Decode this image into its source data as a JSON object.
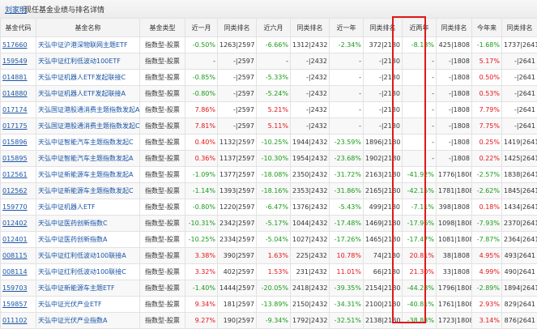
{
  "header": {
    "manager_name": "刘家明",
    "title": "现任基金业绩与排名详情"
  },
  "table": {
    "columns": [
      "基金代码",
      "基金名称",
      "基金类型",
      "近一月",
      "同类排名",
      "近六月",
      "同类排名",
      "近一年",
      "同类排名",
      "近两年",
      "同类排名",
      "今年来",
      "同类排名"
    ],
    "rows": [
      [
        "517660",
        "天弘中证沪港深物联网主题ETF",
        "指数型-股票",
        "-0.50%",
        "1263|2597",
        "-6.66%",
        "1312|2432",
        "-2.34%",
        "372|2180",
        "-8.18%",
        "425|1808",
        "-1.68%",
        "1737|2641"
      ],
      [
        "159549",
        "天弘中证红利低波动100ETF",
        "指数型-股票",
        "-",
        "-|2597",
        "-",
        "-|2432",
        "-",
        "-|2180",
        "-",
        "-|1808",
        "5.17%",
        "-|2641"
      ],
      [
        "014881",
        "天弘中证机器人ETF发起联接C",
        "指数型-股票",
        "-0.85%",
        "-|2597",
        "-5.33%",
        "-|2432",
        "-",
        "-|2180",
        "-",
        "-|1808",
        "0.50%",
        "-|2641"
      ],
      [
        "014880",
        "天弘中证机器人ETF发起联接A",
        "指数型-股票",
        "-0.80%",
        "-|2597",
        "-5.24%",
        "-|2432",
        "-",
        "-|2180",
        "-",
        "-|1808",
        "0.53%",
        "-|2641"
      ],
      [
        "017174",
        "天弘国证港股通消费主题指数发起A",
        "指数型-股票",
        "7.86%",
        "-|2597",
        "5.21%",
        "-|2432",
        "-",
        "-|2180",
        "-",
        "-|1808",
        "7.79%",
        "-|2641"
      ],
      [
        "017175",
        "天弘国证港股通消费主题指数发起C",
        "指数型-股票",
        "7.81%",
        "-|2597",
        "5.11%",
        "-|2432",
        "-",
        "-|2180",
        "-",
        "-|1808",
        "7.75%",
        "-|2641"
      ],
      [
        "015896",
        "天弘中证智能汽车主题指数发起C",
        "指数型-股票",
        "0.40%",
        "1132|2597",
        "-10.25%",
        "1944|2432",
        "-23.59%",
        "1896|2180",
        "-",
        "-|1808",
        "0.25%",
        "1419|2641"
      ],
      [
        "015895",
        "天弘中证智能汽车主题指数发起A",
        "指数型-股票",
        "0.36%",
        "1137|2597",
        "-10.30%",
        "1954|2432",
        "-23.68%",
        "1902|2180",
        "-",
        "-|1808",
        "0.22%",
        "1425|2641"
      ],
      [
        "012561",
        "天弘中证新能源车主题指数发起A",
        "指数型-股票",
        "-1.09%",
        "1377|2597",
        "-18.08%",
        "2350|2432",
        "-31.72%",
        "2163|2180",
        "-41.92%",
        "1776|1808",
        "-2.57%",
        "1838|2641"
      ],
      [
        "012562",
        "天弘中证新能源车主题指数发起C",
        "指数型-股票",
        "-1.14%",
        "1393|2597",
        "-18.16%",
        "2353|2432",
        "-31.86%",
        "2165|2180",
        "-42.15%",
        "1781|1808",
        "-2.62%",
        "1845|2641"
      ],
      [
        "159770",
        "天弘中证机器人ETF",
        "指数型-股票",
        "-0.80%",
        "1220|2597",
        "-6.47%",
        "1376|2432",
        "-5.43%",
        "499|2180",
        "-7.11%",
        "398|1808",
        "0.18%",
        "1434|2641"
      ],
      [
        "012402",
        "天弘中证医药创新指数C",
        "指数型-股票",
        "-10.31%",
        "2342|2597",
        "-5.17%",
        "1044|2432",
        "-17.48%",
        "1469|2180",
        "-17.96%",
        "1098|1808",
        "-7.93%",
        "2370|2641"
      ],
      [
        "012401",
        "天弘中证医药创新指数A",
        "指数型-股票",
        "-10.25%",
        "2334|2597",
        "-5.04%",
        "1027|2432",
        "-17.26%",
        "1465|2180",
        "-17.47%",
        "1081|1808",
        "-7.87%",
        "2364|2641"
      ],
      [
        "008115",
        "天弘中证红利低波动100联接A",
        "指数型-股票",
        "3.38%",
        "390|2597",
        "1.63%",
        "225|2432",
        "10.78%",
        "74|2180",
        "20.81%",
        "38|1808",
        "4.95%",
        "493|2641"
      ],
      [
        "008114",
        "天弘中证红利低波动100联接C",
        "指数型-股票",
        "3.32%",
        "402|2597",
        "1.53%",
        "231|2432",
        "11.01%",
        "66|2180",
        "21.30%",
        "33|1808",
        "4.99%",
        "490|2641"
      ],
      [
        "159703",
        "天弘中证新能源车主题ETF",
        "指数型-股票",
        "-1.40%",
        "1444|2597",
        "-20.05%",
        "2418|2432",
        "-39.35%",
        "2154|2180",
        "-44.28%",
        "1796|1808",
        "-2.89%",
        "1894|2641"
      ],
      [
        "159857",
        "天弘中证光伏产业ETF",
        "指数型-股票",
        "9.34%",
        "181|2597",
        "-13.89%",
        "2150|2432",
        "-34.31%",
        "2100|2180",
        "-40.81%",
        "1761|1808",
        "2.93%",
        "829|2641"
      ],
      [
        "011102",
        "天弘中证光伏产业指数A",
        "指数型-股票",
        "9.27%",
        "190|2597",
        "-9.34%",
        "1792|2432",
        "-32.51%",
        "2138|2180",
        "-38.83%",
        "1723|1808",
        "3.14%",
        "876|2641"
      ]
    ]
  },
  "colors": {
    "positive": "#e3141a",
    "negative": "#1b9a1b",
    "highlight_border": "#e01818"
  }
}
